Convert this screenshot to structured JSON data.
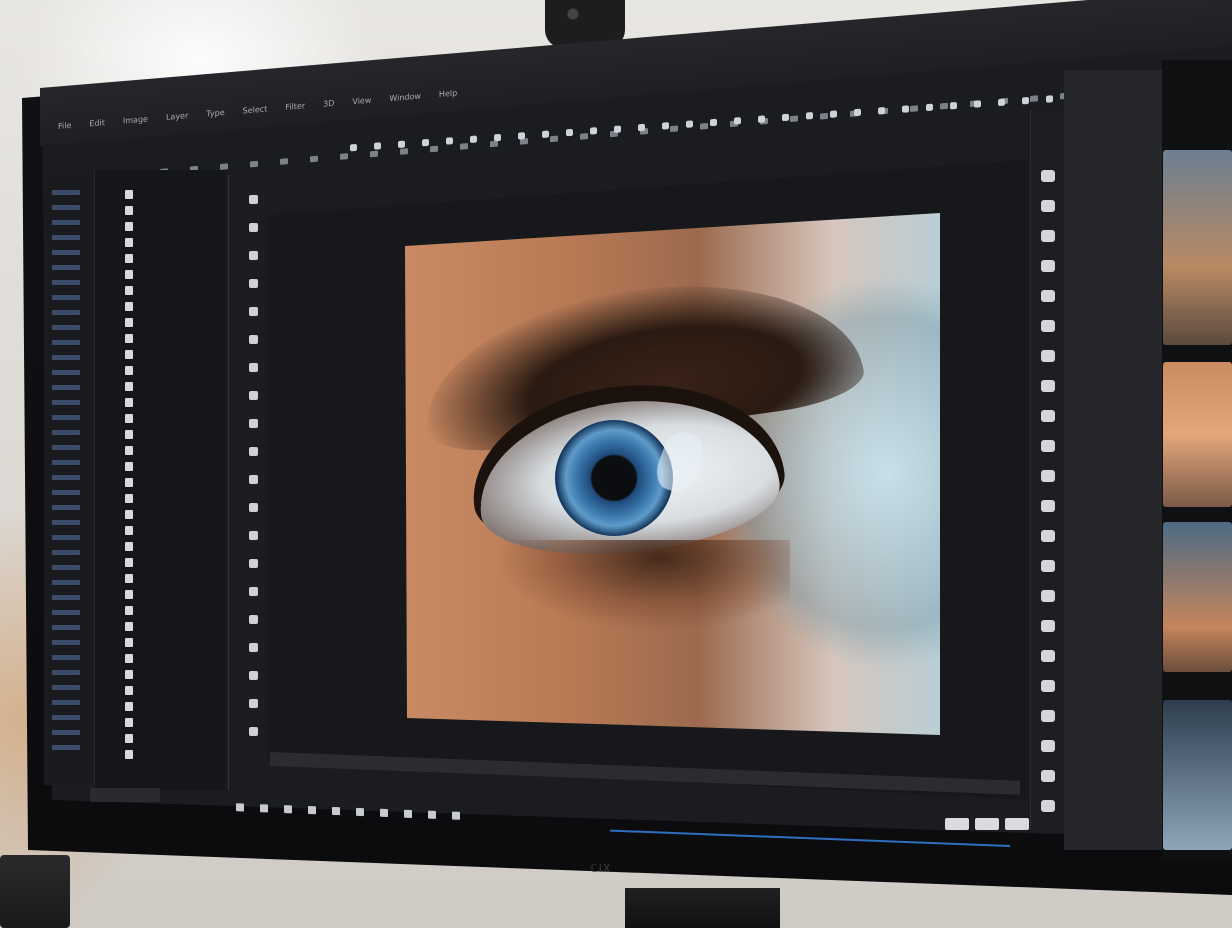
{
  "app": {
    "menu": [
      "File",
      "Edit",
      "Image",
      "Layer",
      "Type",
      "Select",
      "Filter",
      "3D",
      "View",
      "Window",
      "Help"
    ],
    "monitor_logo": "ℂIX"
  },
  "canvas": {
    "subject": "close-up eye photograph"
  },
  "colors": {
    "ui_dark": "#1b1c1f",
    "accent_blue": "#2f6fc0",
    "iris_blue": "#3b78ad"
  }
}
